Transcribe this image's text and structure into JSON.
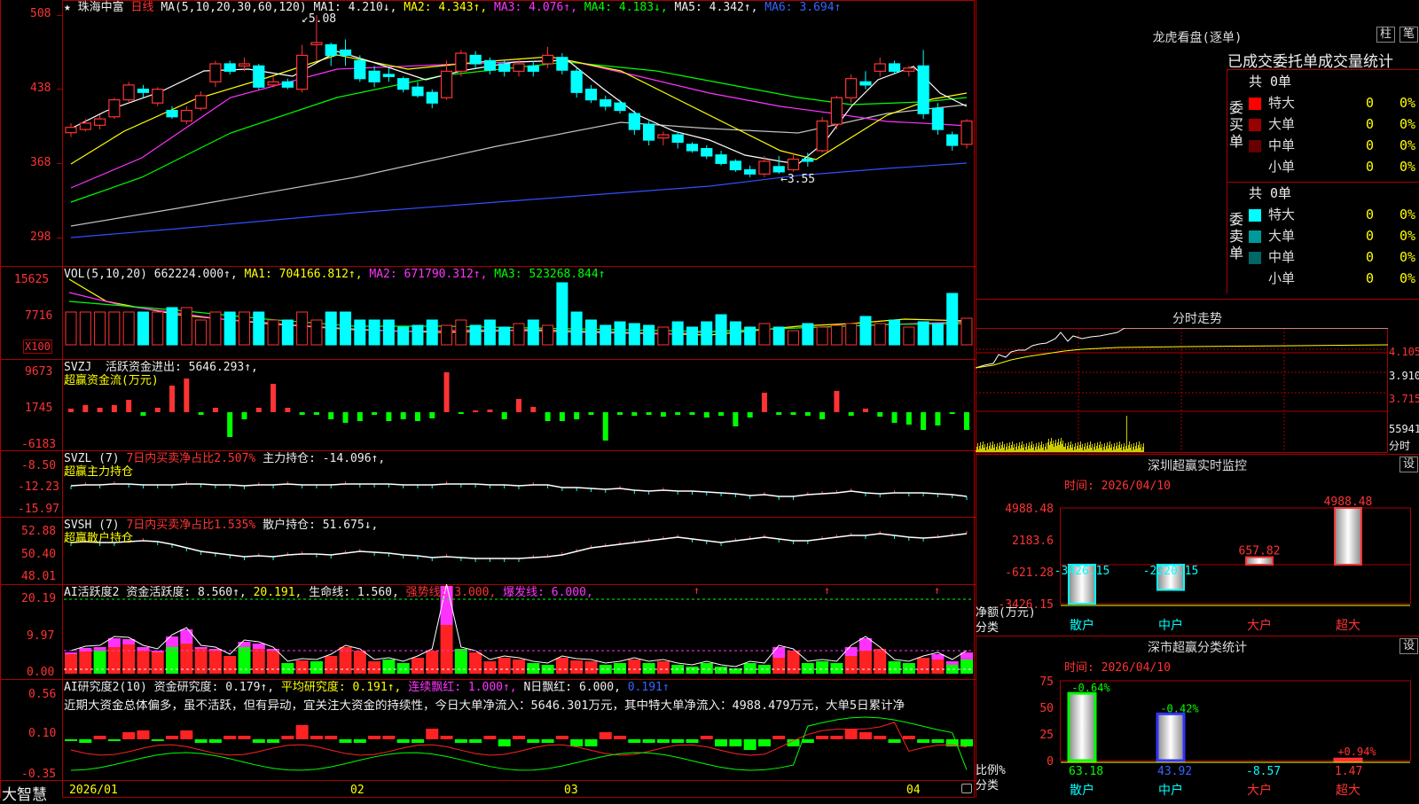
{
  "app": {
    "name": "大智慧",
    "stock_name": "★ 珠海中富",
    "period": "日线"
  },
  "colors": {
    "up": "#ff3333",
    "down": "#00ffff",
    "grid": "#aa0000",
    "text": "#dddddd",
    "ma1": "#ffffff",
    "ma2": "#ffff00",
    "ma3": "#ff33ff",
    "ma4": "#00ff00",
    "ma5": "#c0c0c0",
    "ma6": "#3050ff"
  },
  "price_panel": {
    "indicator": "MA(5,10,20,30,60,120)",
    "items": [
      {
        "label": "MA1: 4.210↓,",
        "color": "#ffffff"
      },
      {
        "label": "MA2: 4.343↑,",
        "color": "#ffff00"
      },
      {
        "label": "MA3: 4.076↑,",
        "color": "#ff33ff"
      },
      {
        "label": "MA4: 4.183↓,",
        "color": "#00ff00"
      },
      {
        "label": "MA5: 4.342↑,",
        "color": "#dddddd"
      },
      {
        "label": "MA6: 3.694↑",
        "color": "#3050ff"
      }
    ],
    "y_ticks": [
      "508",
      "438",
      "368",
      "298"
    ],
    "high_marker": "5.08",
    "low_marker": "←3.55"
  },
  "vol_panel": {
    "title": "VOL(5,10,20)",
    "value": "662224.000↑,",
    "items": [
      {
        "label": "MA1: 704166.812↑,",
        "color": "#ffff00"
      },
      {
        "label": "MA2: 671790.312↑,",
        "color": "#ff33ff"
      },
      {
        "label": "MA3: 523268.844↑",
        "color": "#00ff00"
      }
    ],
    "y_ticks": [
      "15625",
      "7716"
    ],
    "unit": "X100"
  },
  "svzj_panel": {
    "title": "SVZJ",
    "label": "活跃资金进出: 5646.293↑,",
    "sub": "超赢资金流(万元)",
    "y_ticks": [
      "9673",
      "1745",
      "-6183"
    ]
  },
  "svzl_panel": {
    "title": "SVZL (7)",
    "red_label": "7日内买卖净占比2.507%",
    "label": "主力持仓: -14.096↑,",
    "sub": "超赢主力持仓",
    "y_ticks": [
      "-8.50",
      "-12.23",
      "-15.97"
    ]
  },
  "svsh_panel": {
    "title": "SVSH (7)",
    "red_label": "7日内买卖净占比1.535%",
    "label": "散户持仓: 51.675↓,",
    "sub": "超赢散户持仓",
    "y_ticks": [
      "52.88",
      "50.40",
      "48.01"
    ]
  },
  "ai1_panel": {
    "title": "AI活跃度2",
    "items": [
      {
        "label": "资金活跃度: 8.560↑,",
        "color": "#dddddd"
      },
      {
        "label": "20.191,",
        "color": "#ffff00"
      },
      {
        "label": "生命线: 1.560,",
        "color": "#dddddd"
      },
      {
        "label": "强势线: 3.000,",
        "color": "#ff3333"
      },
      {
        "label": "爆发线: 6.000,",
        "color": "#ff33ff"
      }
    ],
    "y_ticks": [
      "20.19",
      "9.97",
      "0.00"
    ]
  },
  "ai2_panel": {
    "title": "AI研究度2(10)",
    "items": [
      {
        "label": "资金研究度: 0.179↑,",
        "color": "#dddddd"
      },
      {
        "label": "平均研究度: 0.191↑,",
        "color": "#ffff00"
      },
      {
        "label": "连续飘红: 1.000↑,",
        "color": "#ff33ff"
      },
      {
        "label": "N日飘红: 6.000,",
        "color": "#dddddd"
      },
      {
        "label": "0.191↑",
        "color": "#3366ff"
      }
    ],
    "comment": "近期大资金总体偏多，虽不活跃，但有异动，宜关注大资金的持续性，今日大单净流入：5646.301万元，其中特大单净流入：4988.479万元，大单5日累计净",
    "y_ticks": [
      "0.56",
      "0.10",
      "-0.35"
    ]
  },
  "x_axis": {
    "labels": [
      "2026/01",
      "02",
      "03",
      "04"
    ]
  },
  "dragon_tiger": {
    "title": "龙虎看盘(逐单)",
    "tabs": [
      "柱",
      "笔"
    ],
    "header": "已成交委托单成交量统计",
    "buy": {
      "side_label": "委买单",
      "total": "共 0单",
      "rows": [
        {
          "label": "特大",
          "value": "0",
          "pct": "0%",
          "color": "#ff0000"
        },
        {
          "label": "大单",
          "value": "0",
          "pct": "0%",
          "color": "#990000"
        },
        {
          "label": "中单",
          "value": "0",
          "pct": "0%",
          "color": "#660000"
        },
        {
          "label": "小单",
          "value": "0",
          "pct": "0%",
          "color": "#000000"
        }
      ]
    },
    "sell": {
      "side_label": "委卖单",
      "total": "共 0单",
      "rows": [
        {
          "label": "特大",
          "value": "0",
          "pct": "0%",
          "color": "#00ffff"
        },
        {
          "label": "大单",
          "value": "0",
          "pct": "0%",
          "color": "#009999"
        },
        {
          "label": "中单",
          "value": "0",
          "pct": "0%",
          "color": "#006666"
        },
        {
          "label": "小单",
          "value": "0",
          "pct": "0%",
          "color": "#000000"
        }
      ]
    }
  },
  "intraday": {
    "title": "分时走势",
    "y_ticks": [
      "4.105",
      "3.910",
      "3.715"
    ],
    "vol_tick": "55941",
    "bottom_label": "分时"
  },
  "monitor": {
    "title": "深圳超赢实时监控",
    "settings": "设",
    "time": "时间: 2026/04/10",
    "y_ticks": [
      "4988.48",
      "2183.6",
      "-621.28",
      "-3426.15"
    ],
    "ylabel": "净额(万元)",
    "xlabel": "分类",
    "categories": [
      "散户",
      "中户",
      "大户",
      "超大"
    ],
    "value_labels": [
      "-3426.15",
      "-2220.15",
      "657.82",
      "4988.48"
    ]
  },
  "classify": {
    "title": "深市超赢分类统计",
    "settings": "设",
    "time": "时间: 2026/04/10",
    "y_ticks": [
      "75",
      "50",
      "25",
      "0"
    ],
    "ylabel": "比例%",
    "xlabel": "分类",
    "categories": [
      "散户",
      "中户",
      "大户",
      "超大"
    ],
    "bottom_values": [
      "63.18",
      "43.92",
      "-8.57",
      "1.47"
    ],
    "pct_labels": [
      "-0.64%",
      "-0.42%",
      "",
      "+0.94%"
    ]
  },
  "chart_data": [
    {
      "type": "bar",
      "title": "深圳超赢实时监控",
      "ylabel": "净额(万元)",
      "xlabel": "分类",
      "categories": [
        "散户",
        "中户",
        "大户",
        "超大"
      ],
      "values": [
        -3426.15,
        -2220.15,
        657.82,
        4988.48
      ],
      "ylim": [
        -3426.15,
        4988.48
      ]
    },
    {
      "type": "bar",
      "title": "深市超赢分类统计",
      "ylabel": "比例%",
      "xlabel": "分类",
      "categories": [
        "散户",
        "中户",
        "大户",
        "超大"
      ],
      "values": [
        63.18,
        43.92,
        -8.57,
        1.47
      ],
      "ylim": [
        0,
        75
      ]
    },
    {
      "type": "candlestick",
      "title": "",
      "ylim": [
        2.98,
        5.08
      ],
      "x_labels": [
        "2026/01",
        "02",
        "03",
        "04"
      ],
      "series": [
        {
          "values": [
            [
              3.97,
              4.02,
              3.93,
              4.06
            ],
            [
              4.0,
              4.06,
              3.98,
              4.1
            ],
            [
              4.04,
              4.1,
              4.0,
              4.14
            ],
            [
              4.12,
              4.28,
              4.1,
              4.3
            ],
            [
              4.28,
              4.42,
              4.25,
              4.45
            ],
            [
              4.38,
              4.35,
              4.3,
              4.42
            ],
            [
              4.25,
              4.38,
              4.22,
              4.4
            ],
            [
              4.18,
              4.12,
              4.1,
              4.22
            ],
            [
              4.08,
              4.18,
              4.05,
              4.22
            ],
            [
              4.2,
              4.32,
              4.18,
              4.36
            ],
            [
              4.45,
              4.62,
              4.4,
              4.65
            ],
            [
              4.62,
              4.55,
              4.52,
              4.65
            ],
            [
              4.6,
              4.62,
              4.55,
              4.68
            ],
            [
              4.6,
              4.4,
              4.38,
              4.62
            ],
            [
              4.42,
              4.45,
              4.4,
              4.5
            ],
            [
              4.45,
              4.4,
              4.38,
              4.48
            ],
            [
              4.38,
              4.7,
              4.35,
              4.8
            ],
            [
              4.8,
              4.82,
              4.65,
              5.08
            ],
            [
              4.8,
              4.7,
              4.6,
              4.82
            ],
            [
              4.75,
              4.7,
              4.6,
              4.85
            ],
            [
              4.65,
              4.48,
              4.45,
              4.7
            ],
            [
              4.55,
              4.45,
              4.4,
              4.6
            ],
            [
              4.52,
              4.5,
              4.45,
              4.58
            ],
            [
              4.48,
              4.38,
              4.35,
              4.5
            ],
            [
              4.4,
              4.32,
              4.3,
              4.45
            ],
            [
              4.35,
              4.25,
              4.2,
              4.38
            ],
            [
              4.3,
              4.55,
              4.28,
              4.65
            ],
            [
              4.55,
              4.72,
              4.5,
              4.75
            ],
            [
              4.7,
              4.62,
              4.58,
              4.74
            ],
            [
              4.65,
              4.56,
              4.52,
              4.68
            ],
            [
              4.62,
              4.55,
              4.5,
              4.65
            ],
            [
              4.55,
              4.62,
              4.5,
              4.66
            ],
            [
              4.6,
              4.55,
              4.5,
              4.65
            ],
            [
              4.62,
              4.7,
              4.58,
              4.78
            ],
            [
              4.68,
              4.56,
              4.52,
              4.72
            ],
            [
              4.55,
              4.35,
              4.3,
              4.58
            ],
            [
              4.38,
              4.28,
              4.25,
              4.42
            ],
            [
              4.28,
              4.22,
              4.18,
              4.32
            ],
            [
              4.25,
              4.18,
              4.15,
              4.28
            ],
            [
              4.15,
              4.0,
              3.95,
              4.18
            ],
            [
              4.05,
              3.9,
              3.85,
              4.08
            ],
            [
              3.92,
              3.95,
              3.85,
              3.98
            ],
            [
              3.95,
              3.88,
              3.82,
              3.98
            ],
            [
              3.86,
              3.8,
              3.78,
              3.88
            ],
            [
              3.82,
              3.75,
              3.72,
              3.85
            ],
            [
              3.76,
              3.68,
              3.66,
              3.8
            ],
            [
              3.7,
              3.62,
              3.6,
              3.72
            ],
            [
              3.62,
              3.58,
              3.55,
              3.66
            ],
            [
              3.58,
              3.7,
              3.55,
              3.75
            ],
            [
              3.65,
              3.6,
              3.58,
              3.75
            ],
            [
              3.62,
              3.72,
              3.6,
              3.78
            ],
            [
              3.72,
              3.7,
              3.65,
              3.78
            ],
            [
              3.8,
              4.08,
              3.78,
              4.12
            ],
            [
              4.05,
              4.3,
              4.0,
              4.32
            ],
            [
              4.3,
              4.48,
              4.25,
              4.52
            ],
            [
              4.45,
              4.42,
              4.38,
              4.55
            ],
            [
              4.55,
              4.62,
              4.5,
              4.68
            ],
            [
              4.62,
              4.55,
              4.52,
              4.65
            ],
            [
              4.55,
              4.58,
              4.5,
              4.6
            ],
            [
              4.6,
              4.15,
              4.1,
              4.75
            ],
            [
              4.2,
              4.0,
              3.95,
              4.25
            ],
            [
              3.95,
              3.85,
              3.8,
              3.98
            ],
            [
              3.86,
              4.08,
              3.82,
              4.1
            ]
          ]
        }
      ]
    }
  ]
}
